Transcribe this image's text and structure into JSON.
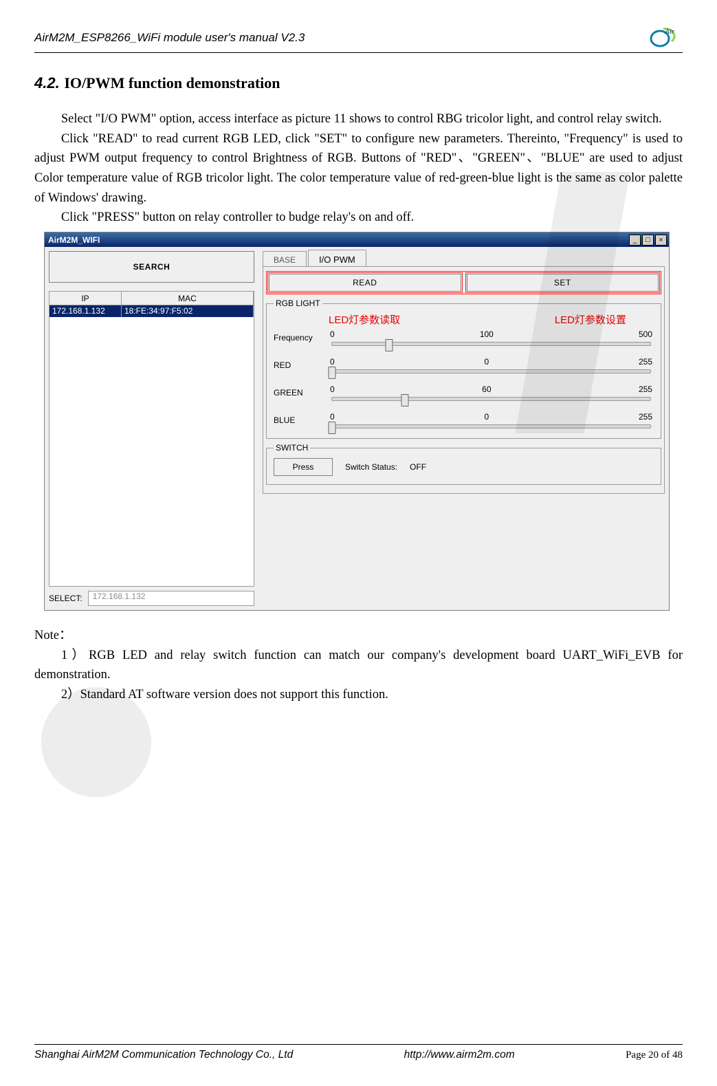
{
  "header": {
    "doc_title": "AirM2M_ESP8266_WiFi module user's manual V2.3",
    "logo_text": "Air"
  },
  "section": {
    "number": "4.2.",
    "title": "IO/PWM function demonstration"
  },
  "para1": "Select \"I/O PWM\" option, access interface as picture 11 shows to control RBG tricolor light, and control relay switch.",
  "para2": "Click \"READ\" to read current RGB LED, click \"SET\" to configure new parameters. Thereinto, \"Frequency\" is used to adjust PWM output frequency to control Brightness of RGB.   Buttons of \"RED\"、\"GREEN\"、\"BLUE\" are used to adjust Color temperature value of RGB tricolor light. The color temperature value of red-green-blue light is the same as color palette of Windows' drawing.",
  "para3": "Click \"PRESS\" button on relay controller to budge relay's on and off.",
  "note_label": "Note：",
  "note1": "1）RGB LED and relay switch function can match our company's development board UART_WiFi_EVB for demonstration.",
  "note2": "2）Standard AT software version does not support this function.",
  "window": {
    "title": "AirM2M_WIFI",
    "search_btn": "SEARCH",
    "grid": {
      "col_ip": "IP",
      "col_mac": "MAC",
      "row_ip": "172.168.1.132",
      "row_mac": "18:FE:34:97:F5:02"
    },
    "select_label": "SELECT:",
    "select_value": "172.168.1.132",
    "tabs": {
      "base": "BASE",
      "iopwm": "I/O PWM"
    },
    "buttons": {
      "read": "READ",
      "set": "SET"
    },
    "annotations": {
      "read": "LED灯参数读取",
      "set": "LED灯参数设置"
    },
    "rgb": {
      "legend": "RGB LIGHT",
      "freq_label": "Frequency",
      "red_label": "RED",
      "green_label": "GREEN",
      "blue_label": "BLUE",
      "freq": {
        "min": "0",
        "mid": "100",
        "max": "500",
        "val_pct": 18
      },
      "red": {
        "min": "0",
        "mid": "0",
        "max": "255",
        "val_pct": 0
      },
      "green": {
        "min": "0",
        "mid": "60",
        "max": "255",
        "val_pct": 23
      },
      "blue": {
        "min": "0",
        "mid": "0",
        "max": "255",
        "val_pct": 0
      }
    },
    "switch": {
      "legend": "SWITCH",
      "press": "Press",
      "status_label": "Switch Status:",
      "status_value": "OFF"
    }
  },
  "footer": {
    "company": "Shanghai AirM2M Communication Technology Co., Ltd",
    "url": "http://www.airm2m.com",
    "page": "Page 20 of 48"
  }
}
